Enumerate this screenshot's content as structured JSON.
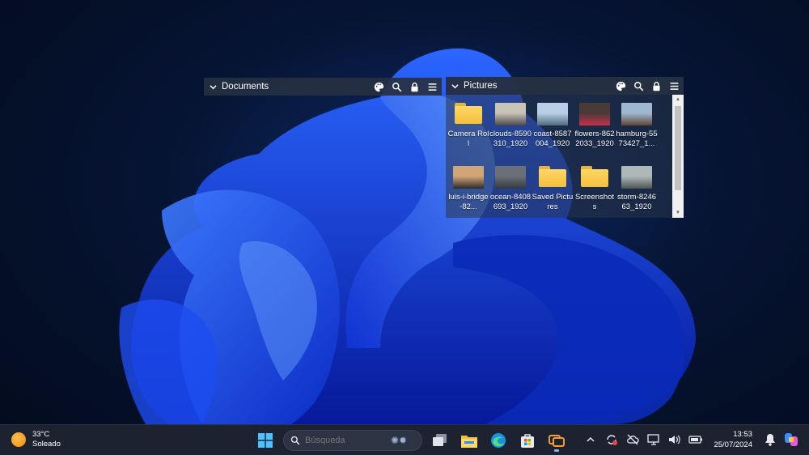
{
  "fences": {
    "documents": {
      "title": "Documents"
    },
    "pictures": {
      "title": "Pictures",
      "items": [
        {
          "label": "Camera Roll",
          "kind": "folder"
        },
        {
          "label": "clouds-8590310_1920",
          "kind": "image",
          "colors": [
            "#c9c2b6",
            "#4a4a4a"
          ]
        },
        {
          "label": "coast-8587004_1920",
          "kind": "image",
          "colors": [
            "#b8cfe6",
            "#51697f"
          ]
        },
        {
          "label": "flowers-8622033_1920",
          "kind": "image",
          "colors": [
            "#4a3a36",
            "#c9304a"
          ]
        },
        {
          "label": "hamburg-5573427_1...",
          "kind": "image",
          "colors": [
            "#9fb8d2",
            "#5d4636"
          ]
        },
        {
          "label": "luis-i-bridge-82...",
          "kind": "image",
          "colors": [
            "#d2a577",
            "#2b2a2b"
          ]
        },
        {
          "label": "ocean-8408693_1920",
          "kind": "image",
          "colors": [
            "#6a6f78",
            "#353a3f"
          ]
        },
        {
          "label": "Saved Pictures",
          "kind": "folder"
        },
        {
          "label": "Screenshots",
          "kind": "folder-doc"
        },
        {
          "label": "storm-824663_1920",
          "kind": "image",
          "colors": [
            "#aeb8b8",
            "#4c5552"
          ]
        }
      ]
    }
  },
  "taskbar": {
    "weather": {
      "temp": "33°C",
      "condition": "Soleado"
    },
    "search_placeholder": "Búsqueda",
    "clock": {
      "time": "13:53",
      "date": "25/07/2024"
    }
  },
  "colors": {
    "accent": "#1f5bff",
    "folder": "#f4bf3a",
    "taskbar": "#1c2230"
  }
}
